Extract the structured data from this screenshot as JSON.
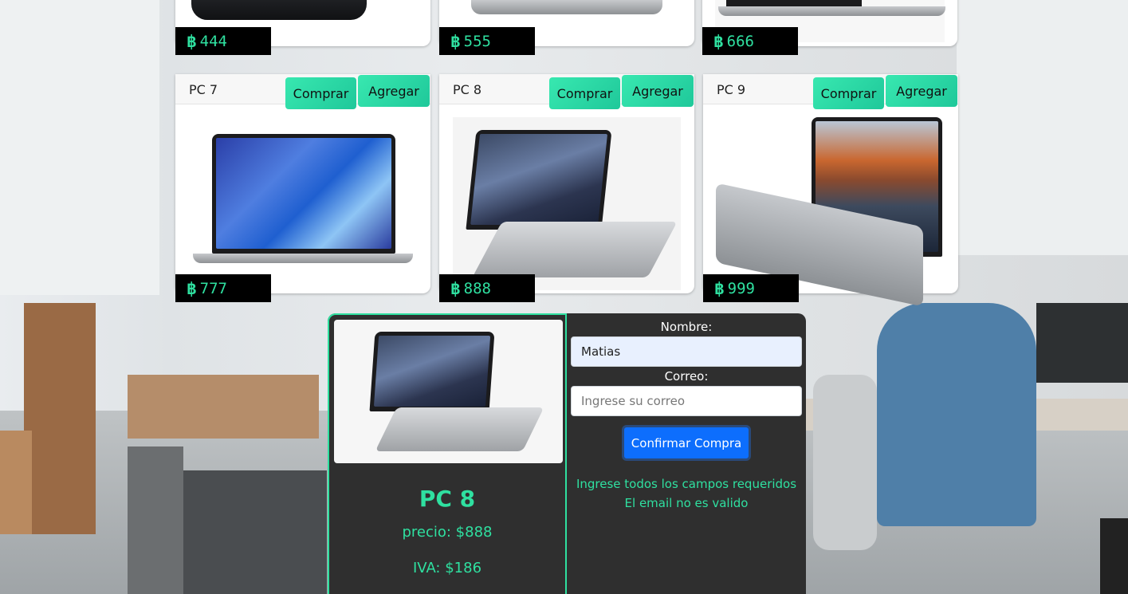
{
  "top_row": [
    {
      "price": "444"
    },
    {
      "price": "555"
    },
    {
      "price": "666"
    }
  ],
  "cards": [
    {
      "title": "PC 7",
      "buy_label": "Comprar",
      "add_label": "Agregar",
      "price": "777"
    },
    {
      "title": "PC 8",
      "buy_label": "Comprar",
      "add_label": "Agregar",
      "price": "888"
    },
    {
      "title": "PC 9",
      "buy_label": "Comprar",
      "add_label": "Agregar",
      "price": "999"
    }
  ],
  "currency_icon": "bitcoin-icon",
  "currency_glyph": "฿",
  "modal": {
    "title": "PC 8",
    "price": "precio: $888",
    "iva": "IVA: $186",
    "name_label": "Nombre:",
    "name_value": "Matias",
    "email_label": "Correo:",
    "email_placeholder": "Ingrese su correo",
    "confirm_label": "Confirmar Compra",
    "error_required": "Ingrese todos los campos requeridos",
    "error_email": "El email no es valido"
  },
  "colors": {
    "accent": "#2fe0a0",
    "button_gradient_start": "#38e8b0",
    "modal_bg": "#2f2f2f",
    "confirm_bg": "#0d6efd",
    "price_tag_bg": "#000000"
  }
}
